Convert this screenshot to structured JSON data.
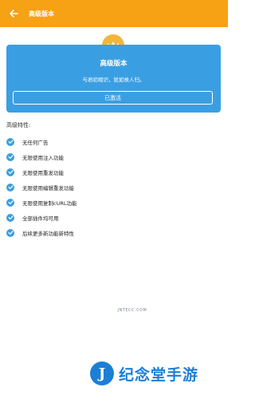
{
  "appbar": {
    "title": "高级版本"
  },
  "card": {
    "title": "高级版本",
    "subtitle": "与君初相识，犹如故人归。",
    "button_label": "已激活"
  },
  "features": {
    "heading": "高级特性:",
    "items": [
      "无任何广告",
      "无限使用注入功能",
      "无限使用重发功能",
      "无限使用编辑重发功能",
      "无限使用复制cURL功能",
      "全部插件均可用",
      "后续更多新功能新特性"
    ]
  },
  "watermark": {
    "url": "JNTECC.COM",
    "brand": "纪念堂手游"
  },
  "colors": {
    "appbar": "#f7a114",
    "card": "#3a9fe2",
    "check": "#3a9fe2"
  }
}
